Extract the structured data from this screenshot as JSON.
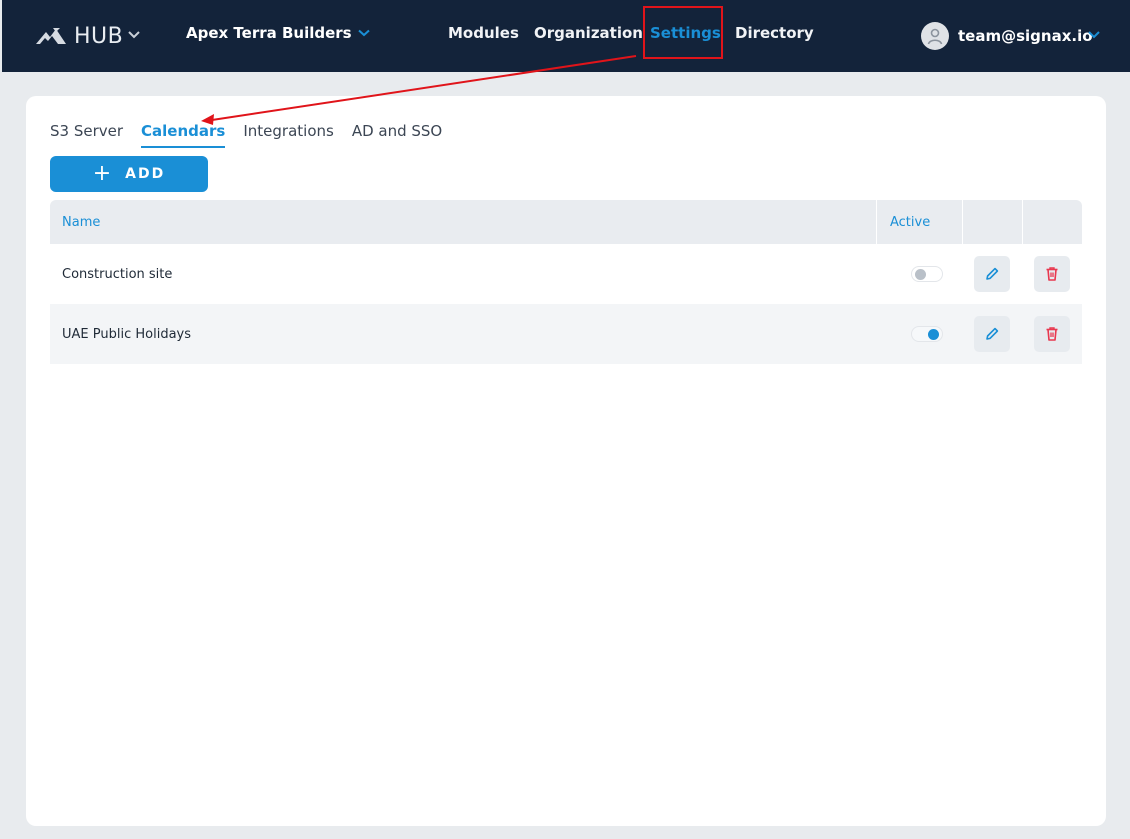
{
  "header": {
    "logo_text": "HUB",
    "org_name": "Apex Terra Builders",
    "nav": [
      {
        "label": "Modules",
        "active": false
      },
      {
        "label": "Organization",
        "active": false
      },
      {
        "label": "Settings",
        "active": true
      },
      {
        "label": "Directory",
        "active": false
      }
    ],
    "user_email": "team@signax.io"
  },
  "tabs": [
    {
      "label": "S3 Server",
      "active": false
    },
    {
      "label": "Calendars",
      "active": true
    },
    {
      "label": "Integrations",
      "active": false
    },
    {
      "label": "AD and SSO",
      "active": false
    }
  ],
  "add_button": {
    "icon": "plus-icon",
    "label": "ADD"
  },
  "table": {
    "columns": {
      "name": "Name",
      "active": "Active"
    },
    "rows": [
      {
        "name": "Construction site",
        "active": false
      },
      {
        "name": "UAE Public Holidays",
        "active": true
      }
    ]
  },
  "colors": {
    "navbar": "#13233a",
    "accent": "#1a8fd6",
    "highlight": "#e0141a",
    "delete": "#e8384f"
  }
}
